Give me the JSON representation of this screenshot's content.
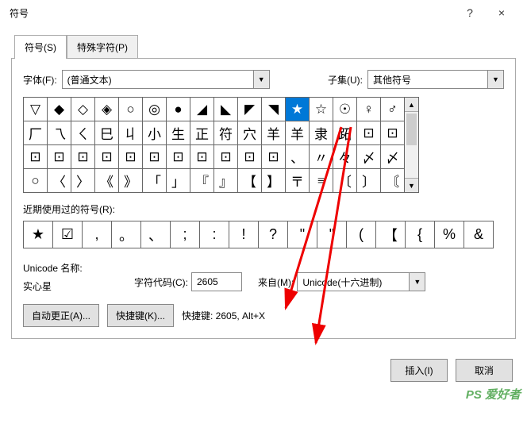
{
  "titlebar": {
    "title": "符号",
    "help": "?",
    "close": "×"
  },
  "tabs": {
    "symbols": "符号(S)",
    "special": "特殊字符(P)"
  },
  "font": {
    "label": "字体(F):",
    "value": "(普通文本)"
  },
  "subset": {
    "label": "子集(U):",
    "value": "其他符号"
  },
  "grid": [
    [
      "▽",
      "◆",
      "◇",
      "◈",
      "○",
      "◎",
      "●",
      "◢",
      "◣",
      "◤",
      "◥",
      "★",
      "☆",
      "☉",
      "♀",
      "♂"
    ],
    [
      "厂",
      "乁",
      "ㄑ",
      "巳",
      "丩",
      "小",
      "生",
      "正",
      "符",
      "穴",
      "羊",
      "羊",
      "隶",
      "跖",
      "⊡",
      "⊡"
    ],
    [
      "⊡",
      "⊡",
      "⊡",
      "⊡",
      "⊡",
      "⊡",
      "⊡",
      "⊡",
      "⊡",
      "⊡",
      "⊡",
      "、",
      "〃",
      "々",
      "〆",
      "〆"
    ],
    [
      "○",
      "〈",
      "〉",
      "《",
      "》",
      "「",
      "」",
      "『",
      "』",
      "【",
      "】",
      "〒",
      "≡",
      "〔",
      "〕",
      "〘"
    ]
  ],
  "grid_selected": {
    "row": 0,
    "col": 11
  },
  "recent_label": "近期使用过的符号(R):",
  "recent": [
    "★",
    "☑",
    ",",
    "。",
    "、",
    ";",
    ":",
    "!",
    "?",
    "\"",
    "\"",
    "(",
    "【",
    "{",
    "%",
    "&"
  ],
  "unicode_name_label": "Unicode 名称:",
  "unicode_name": "实心星",
  "char_code_label": "字符代码(C):",
  "char_code": "2605",
  "from_label": "来自(M):",
  "from_value": "Unicode(十六进制)",
  "autocorrect_btn": "自动更正(A)...",
  "shortcut_btn": "快捷键(K)...",
  "shortcut_label": "快捷键: 2605, Alt+X",
  "insert_btn": "插入(I)",
  "cancel_btn": "取消",
  "watermark": "PS 爱好者"
}
